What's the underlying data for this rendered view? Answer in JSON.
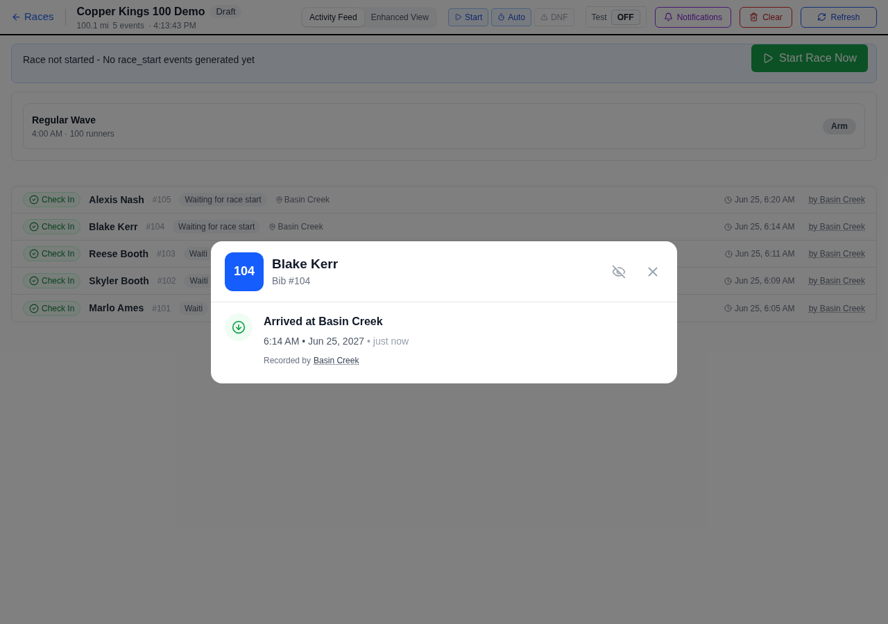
{
  "header": {
    "back": "Races",
    "title": "Copper Kings 100 Demo",
    "status": "Draft",
    "distance": "100.1 mi",
    "events": "5 events",
    "time": "· 4:13:43 PM"
  },
  "view_tabs": [
    {
      "label": "Activity Feed",
      "selected": true
    },
    {
      "label": "Enhanced View",
      "selected": false
    }
  ],
  "actions": [
    {
      "label": "Start",
      "kind": "start",
      "disabled": false
    },
    {
      "label": "Auto",
      "kind": "auto",
      "disabled": false
    },
    {
      "label": "DNF",
      "kind": "dnf",
      "disabled": true
    }
  ],
  "test_mode": {
    "label": "Test",
    "on": false,
    "state_label": "OFF"
  },
  "buttons": [
    {
      "label": "Notifications",
      "kind": "notifications"
    },
    {
      "label": "Clear",
      "kind": "clear"
    },
    {
      "label": "Refresh",
      "kind": "refresh"
    }
  ],
  "banner": {
    "message": "Race not started - No race_start events generated yet",
    "button": "Start Race Now"
  },
  "waves": [
    {
      "name": "Regular Wave",
      "detail": "4:00 AM · 100 runners",
      "button": "Arm"
    }
  ],
  "events": [
    {
      "type": "Check In",
      "name": "Alexis Nash",
      "bib": "#105",
      "status": "Waiting for race start",
      "location": "Basin Creek",
      "time": "Jun 25, 6:20 AM",
      "by": "by Basin Creek"
    },
    {
      "type": "Check In",
      "name": "Blake Kerr",
      "bib": "#104",
      "status": "Waiting for race start",
      "location": "Basin Creek",
      "time": "Jun 25, 6:14 AM",
      "by": "by Basin Creek"
    },
    {
      "type": "Check In",
      "name": "Reese Booth",
      "bib": "#103",
      "status": "Waiti",
      "time": "Jun 25, 6:11 AM",
      "by": "by Basin Creek"
    },
    {
      "type": "Check In",
      "name": "Skyler Booth",
      "bib": "#102",
      "status": "Waiti",
      "time": "Jun 25, 6:09 AM",
      "by": "by Basin Creek"
    },
    {
      "type": "Check In",
      "name": "Marlo Ames",
      "bib": "#101",
      "status": "Waiti",
      "time": "Jun 25, 6:05 AM",
      "by": "by Basin Creek"
    }
  ],
  "modal": {
    "bib_badge": "104",
    "name": "Blake Kerr",
    "bib": "Bib #104",
    "entry": {
      "title": "Arrived at Basin Creek",
      "when": "6:14 AM • Jun 25, 2027",
      "relative": "• just now",
      "recorded_label": "Recorded by",
      "recorded_by": "Basin Creek"
    }
  }
}
